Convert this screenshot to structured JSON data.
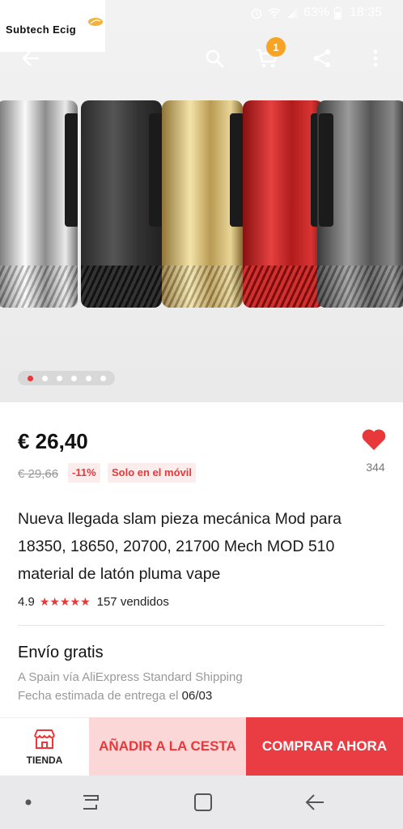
{
  "status_bar": {
    "battery": "63%",
    "time": "18:35"
  },
  "brand": {
    "name": "Subtech Ecig"
  },
  "toolbar": {
    "cart_count": "1"
  },
  "product": {
    "price": "€ 26,40",
    "old_price": "€ 29,66",
    "discount": "-11%",
    "mobile_tag": "Solo en el móvil",
    "likes": "344",
    "title": "Nueva llegada slam pieza mecánica Mod para 18350, 18650, 20700, 21700 Mech MOD 510 material de latón pluma vape",
    "rating": "4.9",
    "stars": "★★★★★",
    "sold": "157 vendidos"
  },
  "shipping": {
    "title": "Envío gratis",
    "method": "A Spain vía AliExpress Standard Shipping",
    "eta_label": "Fecha estimada de entrega el",
    "eta_date": "06/03"
  },
  "actions": {
    "store_label": "TIENDA",
    "add_to_cart": "AÑADIR A LA CESTA",
    "buy_now": "COMPRAR AHORA"
  },
  "carousel": {
    "count": 6,
    "active": 0
  },
  "colors": {
    "accent": "#e8383a",
    "badge": "#f7a324"
  },
  "icons": [
    "back-arrow-icon",
    "search-icon",
    "cart-icon",
    "share-icon",
    "more-vert-icon",
    "heart-icon",
    "store-icon",
    "recents-icon",
    "home-icon",
    "back-nav-icon"
  ]
}
